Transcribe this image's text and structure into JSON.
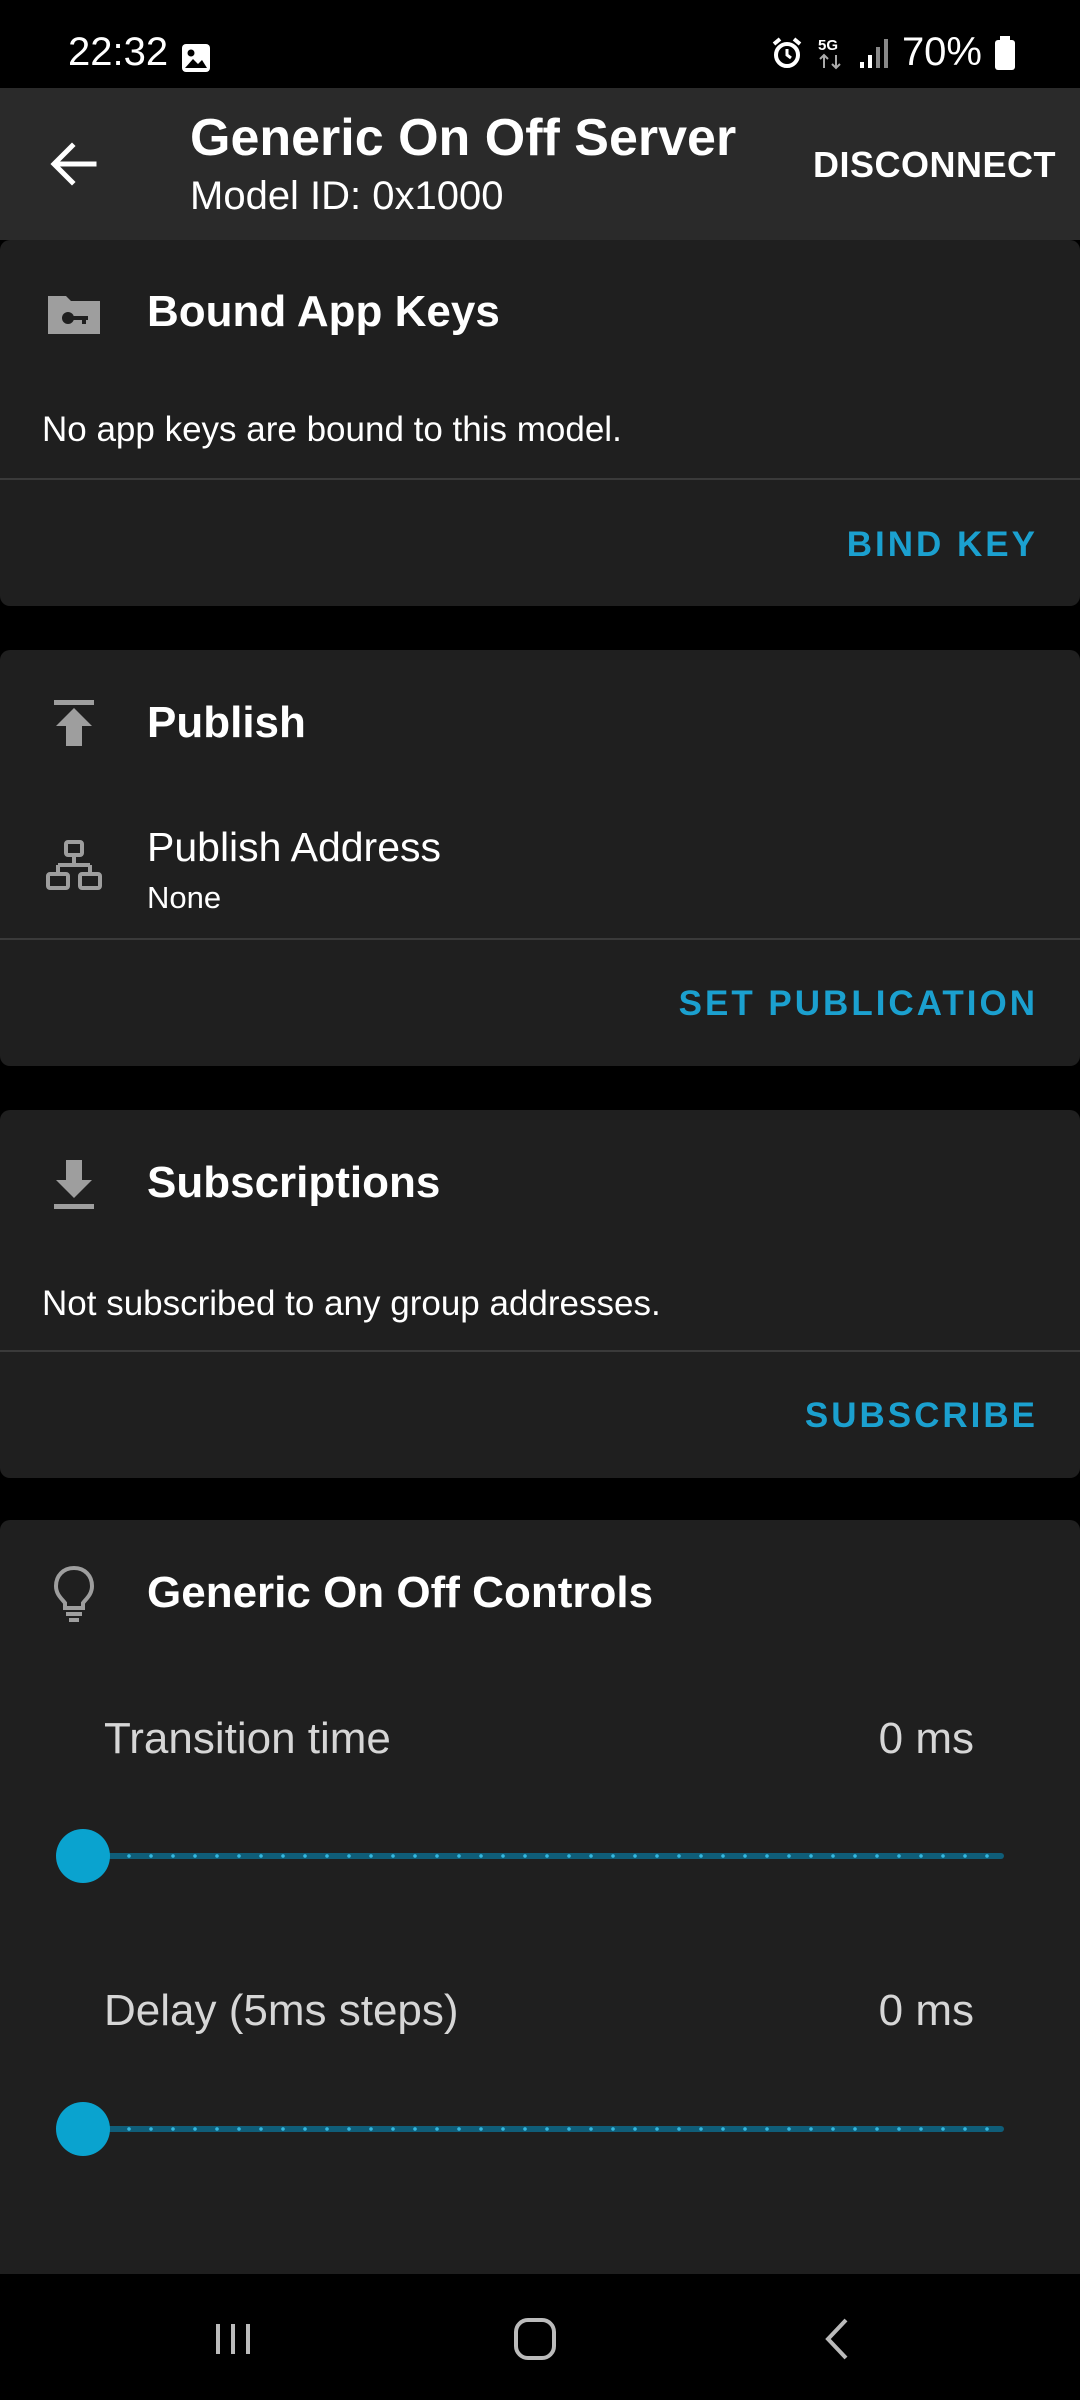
{
  "status": {
    "time": "22:32",
    "battery": "70%"
  },
  "appbar": {
    "title": "Generic On Off Server",
    "subtitle": "Model ID: 0x1000",
    "disconnect_label": "DISCONNECT"
  },
  "bound_keys": {
    "title": "Bound App Keys",
    "message": "No app keys are bound to this model.",
    "action_label": "BIND KEY"
  },
  "publish": {
    "title": "Publish",
    "address_label": "Publish Address",
    "address_value": "None",
    "action_label": "SET PUBLICATION"
  },
  "subscriptions": {
    "title": "Subscriptions",
    "message": "Not subscribed to any group addresses.",
    "action_label": "SUBSCRIBE"
  },
  "controls": {
    "title": "Generic On Off Controls",
    "transition": {
      "label": "Transition time",
      "value_text": "0 ms",
      "level": 0
    },
    "delay": {
      "label": "Delay (5ms steps)",
      "value_text": "0 ms",
      "level": 0
    }
  },
  "colors": {
    "accent": "#1ba0cf",
    "card": "#1f1f1f",
    "appbar": "#2a2a2a",
    "background": "#000000"
  },
  "icons": {
    "status": [
      "gallery-icon",
      "alarm-icon",
      "5g-icon",
      "signal-icon",
      "battery-icon"
    ],
    "cards": [
      "folder-key-icon",
      "publish-icon",
      "network-icon",
      "download-icon",
      "lightbulb-icon"
    ],
    "nav": [
      "recents-icon",
      "home-icon",
      "back-nav-icon"
    ]
  }
}
